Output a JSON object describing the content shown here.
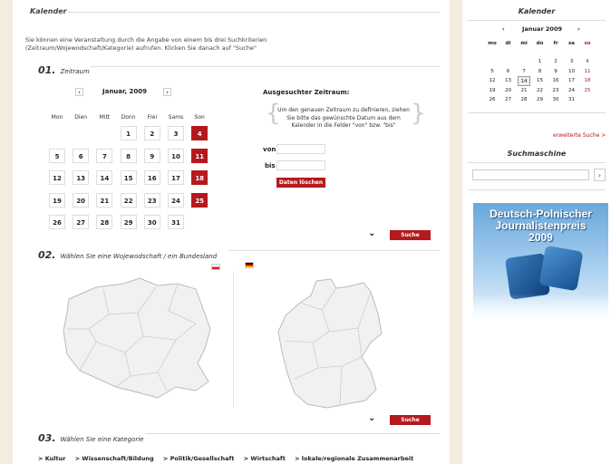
{
  "main": {
    "title": "Kalender",
    "intro": "Sie können eine Veranstaltung durch die Angabe von einem bis drei Suchkriterien (Zeitraum/Wojewodschaft/Kategorie) aufrufen. Klicken Sie danach auf \"Suche\"",
    "step1": {
      "num": "01.",
      "label": "Zeitraum"
    },
    "calendar": {
      "prev_icon": "chevron-left-icon",
      "next_icon": "chevron-right-icon",
      "month": "Januar, 2009",
      "weekdays": [
        "Mon",
        "Dien",
        "Mitt",
        "Donn",
        "Frei",
        "Sams",
        "Son"
      ],
      "weeks": [
        [
          "",
          "",
          "",
          "1",
          "2",
          "3",
          "4"
        ],
        [
          "5",
          "6",
          "7",
          "8",
          "9",
          "10",
          "11"
        ],
        [
          "12",
          "13",
          "14",
          "15",
          "16",
          "17",
          "18"
        ],
        [
          "19",
          "20",
          "21",
          "22",
          "23",
          "24",
          "25"
        ],
        [
          "26",
          "27",
          "28",
          "29",
          "30",
          "31",
          ""
        ]
      ]
    },
    "selected_range": {
      "title": "Ausgesuchter Zeitraum:",
      "help": "Um den genauen Zeitraum zu definieren, ziehen Sie bitte das gewünschte Datum aus dem Kalender in die Felder \"von\" bzw. \"bis\"",
      "von_label": "von",
      "von_value": "",
      "bis_label": "bis",
      "bis_value": "",
      "clear_button": "Daten löschen"
    },
    "search_button": "Suche",
    "step2": {
      "num": "02.",
      "label": "Wählen Sie eine Wojewodschaft / ein Bundesland"
    },
    "step3": {
      "num": "03.",
      "label": "Wählen Sie eine Kategorie"
    },
    "categories": [
      "> Kultur",
      "> Wissenschaft/Bildung",
      "> Politik/Gesellschaft",
      "> Wirtschaft",
      "> lokale/regionale Zusammenarbeit"
    ]
  },
  "sidebar": {
    "calendar_title": "Kalender",
    "month": "Januar 2009",
    "weekdays": [
      "mo",
      "di",
      "mi",
      "do",
      "fr",
      "sa",
      "so"
    ],
    "weeks": [
      [
        "",
        "",
        "",
        "1",
        "2",
        "3",
        "4"
      ],
      [
        "5",
        "6",
        "7",
        "8",
        "9",
        "10",
        "11"
      ],
      [
        "12",
        "13",
        "14",
        "15",
        "16",
        "17",
        "18"
      ],
      [
        "19",
        "20",
        "21",
        "22",
        "23",
        "24",
        "25"
      ],
      [
        "26",
        "27",
        "28",
        "29",
        "30",
        "31",
        ""
      ]
    ],
    "today": "14",
    "extended_search": "erweiterte Suche >",
    "search_title": "Suchmaschine",
    "search_value": "",
    "banner_text": "Deutsch-Polnischer\nJournalistenpreis\n2009"
  },
  "colors": {
    "accent": "#b5191d",
    "background": "#f3ece0"
  }
}
